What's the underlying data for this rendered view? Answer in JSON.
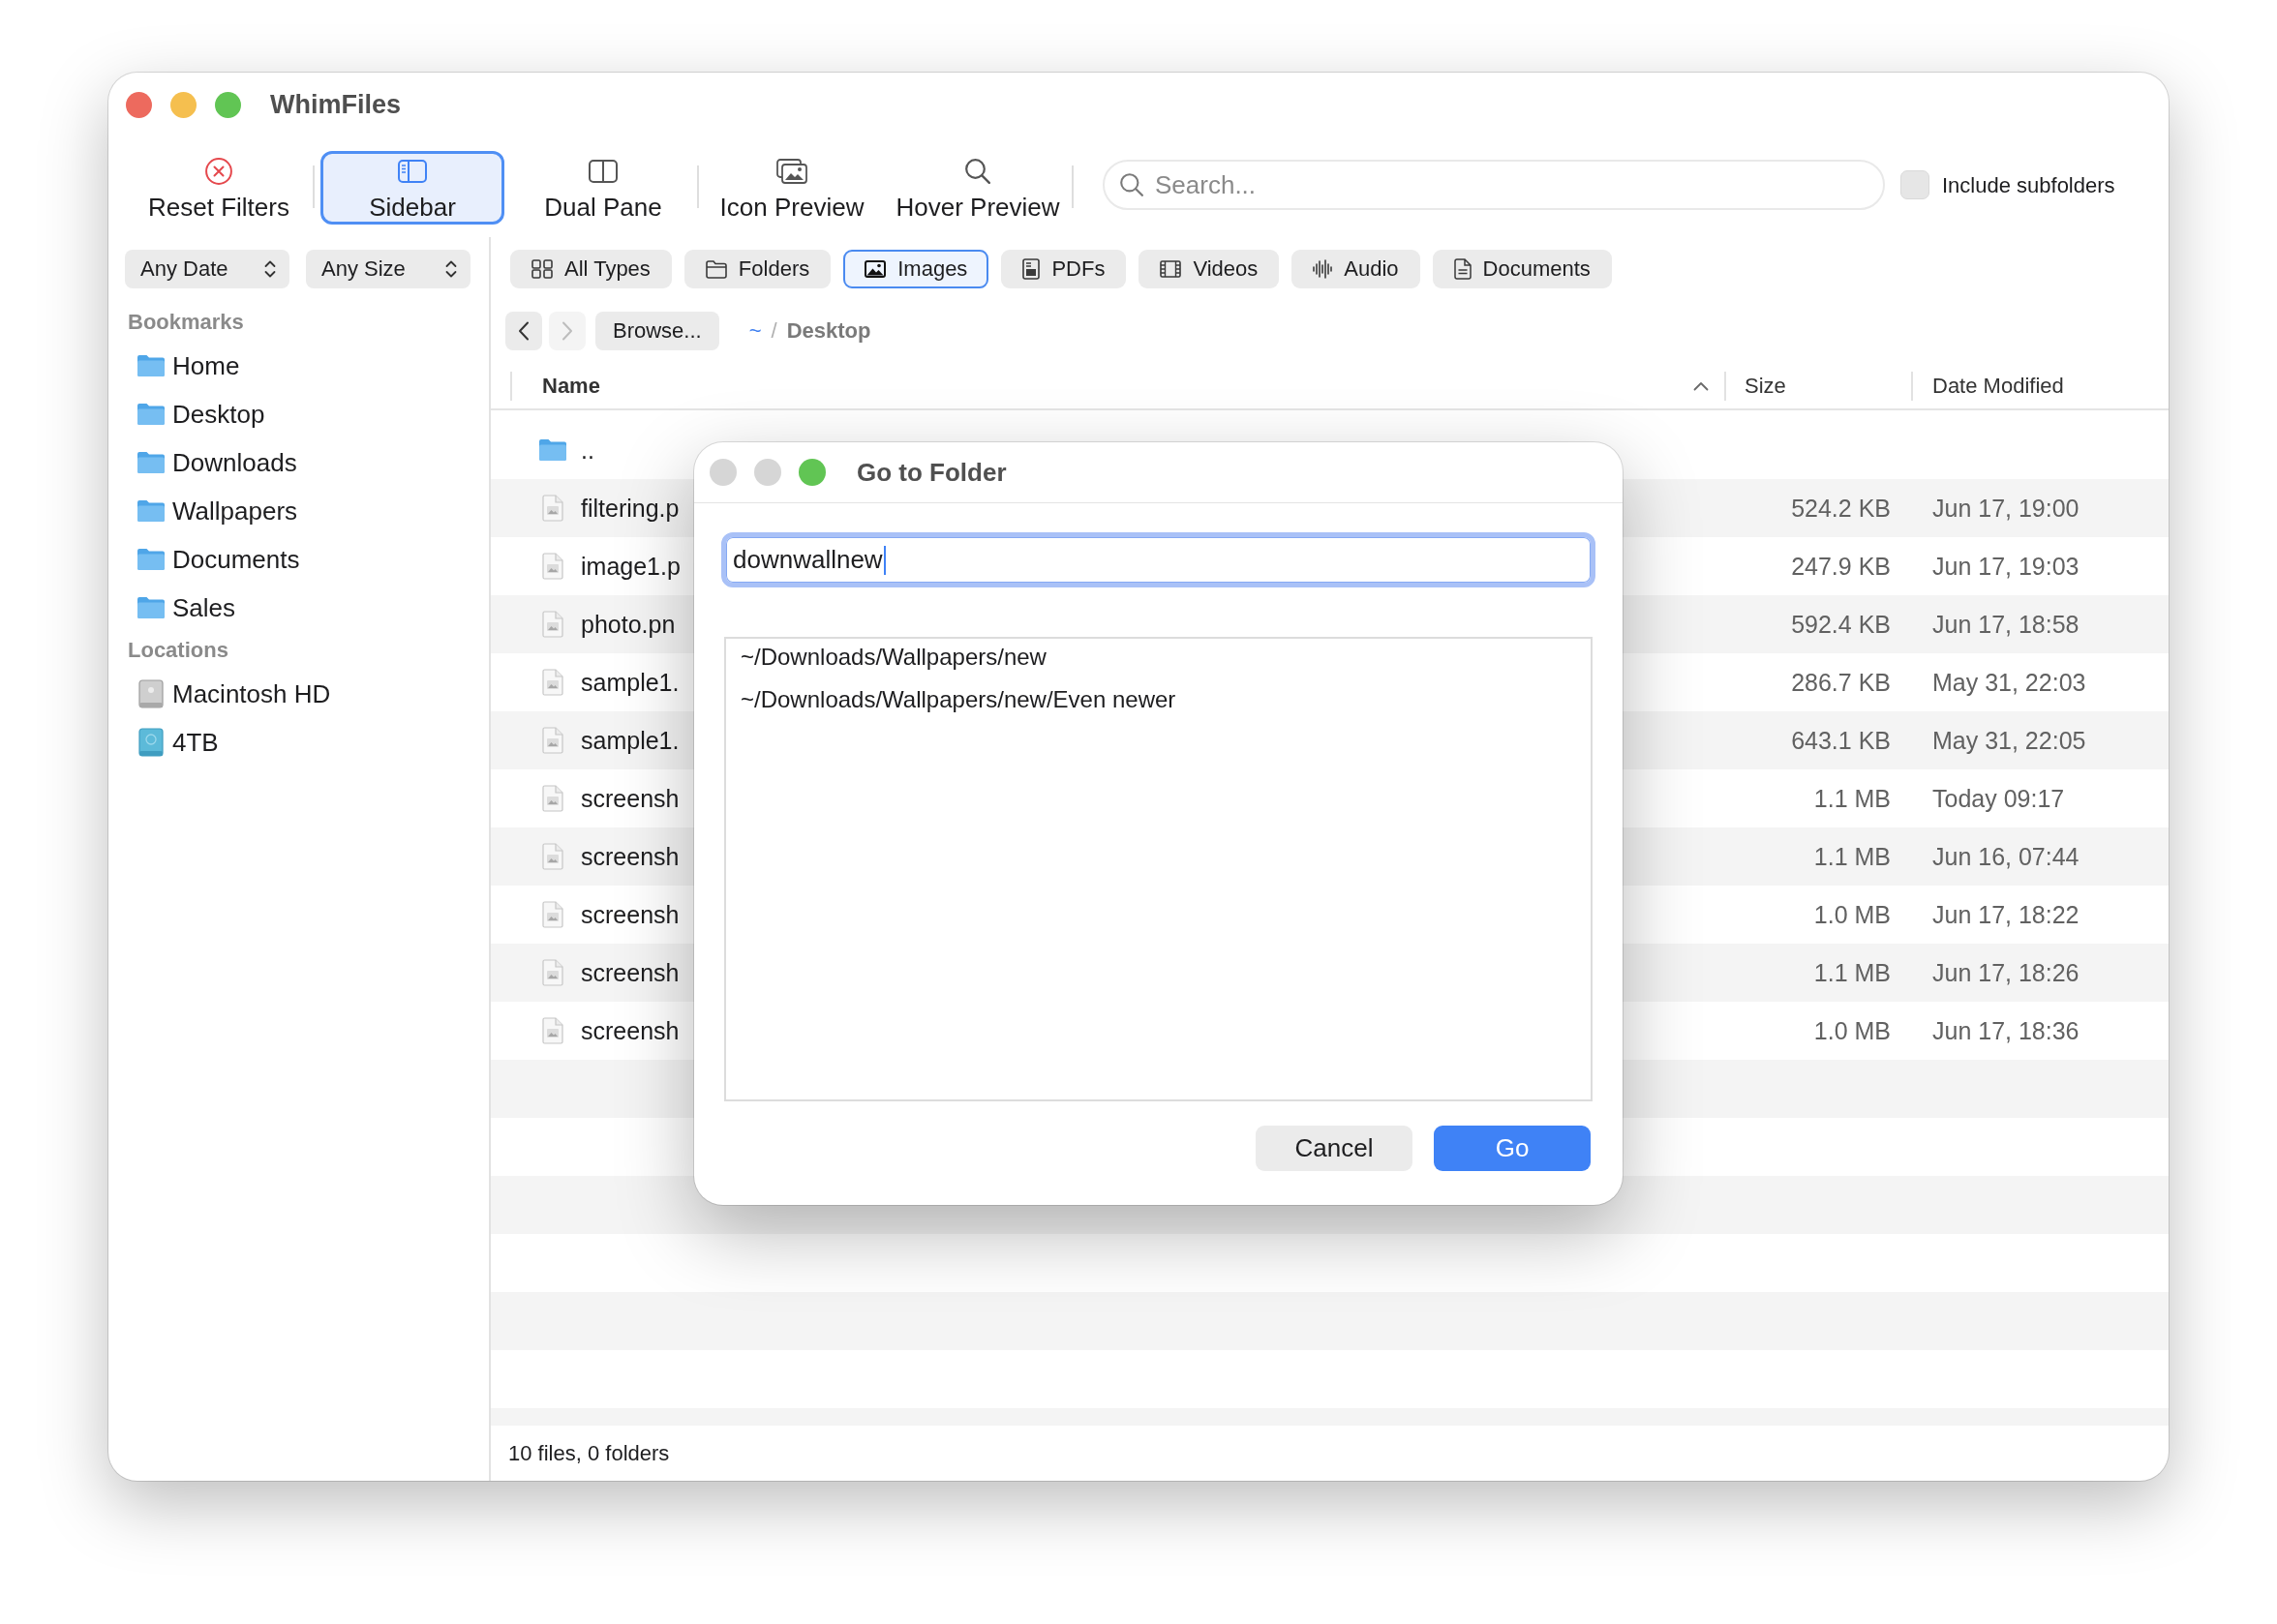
{
  "window": {
    "title": "WhimFiles",
    "controls": [
      {
        "color": "#ed6a5e"
      },
      {
        "color": "#f5bf4f"
      },
      {
        "color": "#61c554"
      }
    ]
  },
  "toolbar": {
    "groups": [
      {
        "buttons": [
          {
            "kind": "reset",
            "label": "Reset Filters",
            "selected": false
          }
        ]
      },
      {
        "buttons": [
          {
            "kind": "sidebar",
            "label": "Sidebar",
            "selected": true
          },
          {
            "kind": "dual-pane",
            "label": "Dual Pane",
            "selected": false
          }
        ]
      },
      {
        "buttons": [
          {
            "kind": "icon-preview",
            "label": "Icon Preview",
            "selected": false
          },
          {
            "kind": "hover-preview",
            "label": "Hover Preview",
            "selected": false
          }
        ]
      }
    ],
    "search": {
      "placeholder": "Search..."
    },
    "include_subfolders": {
      "label": "Include subfolders",
      "checked": false
    }
  },
  "filters": {
    "popups": [
      {
        "label": "Any Date"
      },
      {
        "label": "Any Size"
      }
    ],
    "types": [
      {
        "kind": "all",
        "label": "All Types",
        "selected": false
      },
      {
        "kind": "folder",
        "label": "Folders",
        "selected": false
      },
      {
        "kind": "image",
        "label": "Images",
        "selected": true
      },
      {
        "kind": "pdf",
        "label": "PDFs",
        "selected": false
      },
      {
        "kind": "video",
        "label": "Videos",
        "selected": false
      },
      {
        "kind": "audio",
        "label": "Audio",
        "selected": false
      },
      {
        "kind": "document",
        "label": "Documents",
        "selected": false
      }
    ]
  },
  "sidebar": {
    "sections": [
      {
        "title": "Bookmarks",
        "items": [
          {
            "kind": "home",
            "label": "Home",
            "selected": false
          },
          {
            "kind": "desktop",
            "label": "Desktop",
            "selected": false
          },
          {
            "kind": "downloads",
            "label": "Downloads",
            "selected": false
          },
          {
            "kind": "folder",
            "label": "Wallpapers",
            "selected": false
          },
          {
            "kind": "folder",
            "label": "Documents",
            "selected": false
          },
          {
            "kind": "folder",
            "label": "Sales",
            "selected": false
          }
        ]
      },
      {
        "title": "Locations",
        "items": [
          {
            "kind": "internal-drive",
            "label": "Macintosh HD",
            "selected": false
          },
          {
            "kind": "external-drive",
            "label": "4TB",
            "selected": false
          }
        ]
      }
    ]
  },
  "navigation": {
    "back": {
      "disabled": false
    },
    "forward": {
      "disabled": true
    },
    "browse": {
      "label": "Browse..."
    },
    "path": [
      {
        "kind": "link",
        "label": "~"
      },
      {
        "kind": "separator",
        "label": "/"
      },
      {
        "kind": "current",
        "label": "Desktop"
      }
    ]
  },
  "table": {
    "columns": [
      {
        "label": "Name",
        "sorted": true
      },
      {
        "label": "Size",
        "sorted": false
      },
      {
        "label": "Date Modified",
        "sorted": false
      }
    ],
    "rows": [
      {
        "kind": "folder",
        "name": ".."
      },
      {
        "kind": "image",
        "name": "filtering.p",
        "size": "524.2 KB",
        "modified": "Jun 17, 19:00"
      },
      {
        "kind": "image",
        "name": "image1.p",
        "size": "247.9 KB",
        "modified": "Jun 17, 19:03"
      },
      {
        "kind": "image",
        "name": "photo.pn",
        "size": "592.4 KB",
        "modified": "Jun 17, 18:58"
      },
      {
        "kind": "image",
        "name": "sample1.",
        "size": "286.7 KB",
        "modified": "May 31, 22:03"
      },
      {
        "kind": "image",
        "name": "sample1.",
        "size": "643.1 KB",
        "modified": "May 31, 22:05"
      },
      {
        "kind": "image",
        "name": "screensh",
        "size": "1.1 MB",
        "modified": "Today 09:17"
      },
      {
        "kind": "image",
        "name": "screensh",
        "size": "1.1 MB",
        "modified": "Jun 16, 07:44"
      },
      {
        "kind": "image",
        "name": "screensh",
        "size": "1.0 MB",
        "modified": "Jun 17, 18:22"
      },
      {
        "kind": "image",
        "name": "screensh",
        "size": "1.1 MB",
        "modified": "Jun 17, 18:26"
      },
      {
        "kind": "image",
        "name": "screensh",
        "size": "1.0 MB",
        "modified": "Jun 17, 18:36"
      }
    ]
  },
  "status_bar": {
    "text": "10 files, 0 folders"
  },
  "dialog": {
    "title": "Go to Folder",
    "controls": [
      {
        "color": "#d6d6d6"
      },
      {
        "color": "#d6d6d6"
      },
      {
        "color": "#61c554"
      }
    ],
    "path_field": {
      "value": "downwallnew",
      "focused": true
    },
    "suggestions": [
      {
        "label": "~/Downloads/Wallpapers/new",
        "selected": false
      },
      {
        "label": "~/Downloads/Wallpapers/new/Even newer",
        "selected": false
      }
    ],
    "buttons": [
      {
        "kind": "secondary",
        "label": "Cancel"
      },
      {
        "kind": "primary",
        "label": "Go"
      }
    ]
  }
}
